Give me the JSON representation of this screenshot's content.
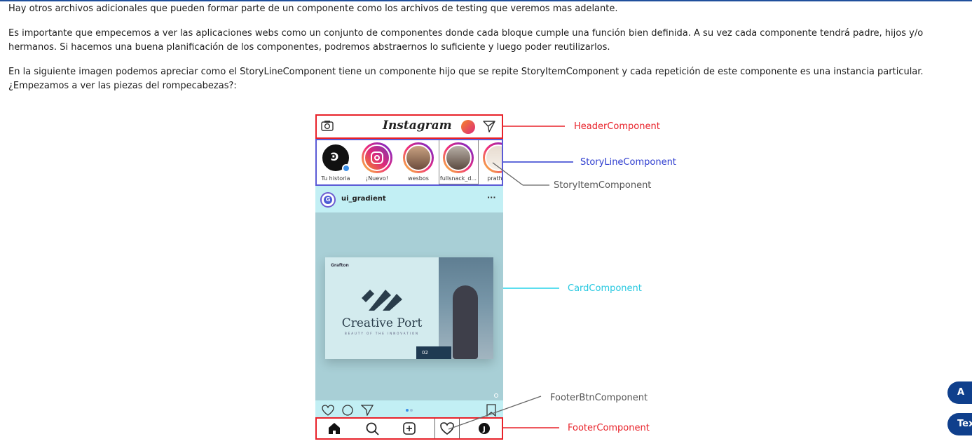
{
  "article": {
    "paragraphs": [
      "Hay otros archivos adicionales que pueden formar parte de un componente como los archivos de testing que veremos mas adelante.",
      "Es importante que empecemos a ver las aplicaciones webs como un conjunto de componentes donde cada bloque cumple una función bien definida. A su vez cada componente tendrá padre, hijos y/o hermanos. Si hacemos una buena planificación de los componentes, podremos abstraernos lo suficiente y luego poder reutilizarlos.",
      "En la siguiente imagen podemos apreciar como el StoryLineComponent tiene un componente hijo que se repite StoryItemComponent y cada repetición de este componente es una instancia particular. ¿Empezamos a ver las piezas del rompecabezas?:"
    ]
  },
  "figure": {
    "app_logo": "Instagram",
    "stories": [
      {
        "label": "Tu historia",
        "icon": "user-avatar-icon"
      },
      {
        "label": "¡Nuevo!",
        "icon": "instagram-icon"
      },
      {
        "label": "wesbos",
        "icon": "user-avatar-icon"
      },
      {
        "label": "fullsnack_d...",
        "icon": "user-avatar-icon"
      },
      {
        "label": "prathan",
        "icon": "user-avatar-icon"
      }
    ],
    "post": {
      "avatar_letter": "G",
      "username": "ui_gradient",
      "menu": "···",
      "card_brand": "Grafton",
      "card_title": "Creative Port",
      "card_subtitle": "BEAUTY OF THE INNOVATION",
      "card_number": "02"
    },
    "annotations": {
      "header": {
        "label": "HeaderComponent",
        "color": "#e8222a"
      },
      "storyline": {
        "label": "StoryLineComponent",
        "color": "#2d3ccf"
      },
      "storyitem": {
        "label": "StoryItemComponent",
        "color": "#555555"
      },
      "card": {
        "label": "CardComponent",
        "color": "#27d3ea"
      },
      "footerbtn": {
        "label": "FooterBtnComponent",
        "color": "#555555"
      },
      "footer": {
        "label": "FooterComponent",
        "color": "#e8222a"
      }
    }
  },
  "floating": {
    "button_top": "A",
    "button_bottom": "Tex"
  }
}
